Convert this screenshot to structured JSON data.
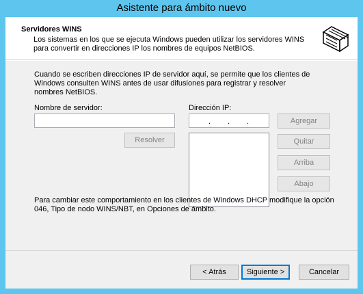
{
  "window": {
    "title": "Asistente para ámbito nuevo"
  },
  "header": {
    "title": "Servidores WINS",
    "description": "Los sistemas en los que se ejecuta Windows pueden utilizar los servidores WINS para convertir en direcciones IP los nombres de equipos NetBIOS."
  },
  "body": {
    "intro": "Cuando se escriben direcciones IP de servidor aquí, se permite que los clientes de Windows consulten WINS antes de usar difusiones para registrar y resolver nombres NetBIOS.",
    "server_name_label": "Nombre de servidor:",
    "server_name_value": "",
    "ip_label": "Dirección IP:",
    "ip_dots": [
      ".",
      ".",
      "."
    ],
    "resolve_label": "Resolver",
    "add_label": "Agregar",
    "remove_label": "Quitar",
    "up_label": "Arriba",
    "down_label": "Abajo",
    "footer_note": "Para cambiar este comportamiento en los clientes de Windows DHCP modifique la opción 046, Tipo de nodo WINS/NBT, en Opciones de ámbito."
  },
  "nav": {
    "back_label": "< Atrás",
    "next_label": "Siguiente >",
    "cancel_label": "Cancelar"
  }
}
